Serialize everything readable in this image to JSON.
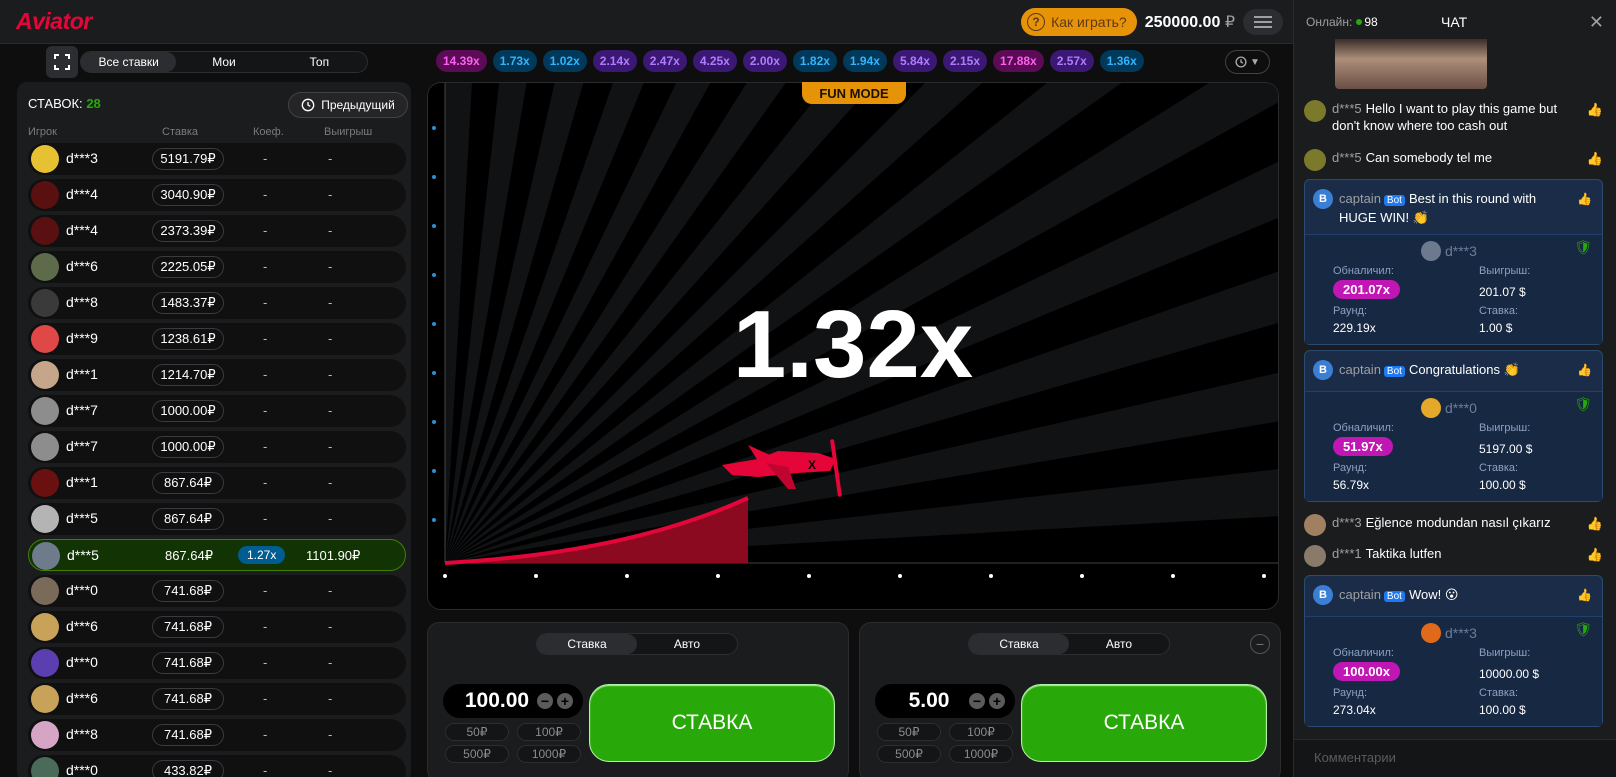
{
  "topbar": {
    "logo": "Aviator",
    "howto_label": "Как играть?",
    "balance_value": "250000.00",
    "balance_currency": "₽"
  },
  "left_tabs": [
    "Все ставки",
    "Мои",
    "Топ"
  ],
  "bets": {
    "label": "СТАВОК:",
    "count": "28",
    "prev_label": "Предыдущий",
    "columns": [
      "Игрок",
      "Ставка",
      "Коеф.",
      "Выигрыш"
    ],
    "rows": [
      {
        "name": "d***3",
        "bet": "5191.79₽",
        "coef": "-",
        "win": "-",
        "color": "#e6c233"
      },
      {
        "name": "d***4",
        "bet": "3040.90₽",
        "coef": "-",
        "win": "-",
        "color": "#5a1010"
      },
      {
        "name": "d***4",
        "bet": "2373.39₽",
        "coef": "-",
        "win": "-",
        "color": "#5a1010"
      },
      {
        "name": "d***6",
        "bet": "2225.05₽",
        "coef": "-",
        "win": "-",
        "color": "#5d6b4a"
      },
      {
        "name": "d***8",
        "bet": "1483.37₽",
        "coef": "-",
        "win": "-",
        "color": "#3a3a3a"
      },
      {
        "name": "d***9",
        "bet": "1238.61₽",
        "coef": "-",
        "win": "-",
        "color": "#e04848"
      },
      {
        "name": "d***1",
        "bet": "1214.70₽",
        "coef": "-",
        "win": "-",
        "color": "#c6a68b"
      },
      {
        "name": "d***7",
        "bet": "1000.00₽",
        "coef": "-",
        "win": "-",
        "color": "#8d8d8d"
      },
      {
        "name": "d***7",
        "bet": "1000.00₽",
        "coef": "-",
        "win": "-",
        "color": "#8d8d8d"
      },
      {
        "name": "d***1",
        "bet": "867.64₽",
        "coef": "-",
        "win": "-",
        "color": "#6b1010"
      },
      {
        "name": "d***5",
        "bet": "867.64₽",
        "coef": "-",
        "win": "-",
        "color": "#b4b4b4"
      },
      {
        "name": "d***5",
        "bet": "867.64₽",
        "coef": "1.27x",
        "win": "1101.90₽",
        "color": "#6e7b8b",
        "win_row": true
      },
      {
        "name": "d***0",
        "bet": "741.68₽",
        "coef": "-",
        "win": "-",
        "color": "#7a6a5a"
      },
      {
        "name": "d***6",
        "bet": "741.68₽",
        "coef": "-",
        "win": "-",
        "color": "#c9a25a"
      },
      {
        "name": "d***0",
        "bet": "741.68₽",
        "coef": "-",
        "win": "-",
        "color": "#5b3fb1"
      },
      {
        "name": "d***6",
        "bet": "741.68₽",
        "coef": "-",
        "win": "-",
        "color": "#c9a25a"
      },
      {
        "name": "d***8",
        "bet": "741.68₽",
        "coef": "-",
        "win": "-",
        "color": "#d6a4c4"
      },
      {
        "name": "d***0",
        "bet": "433.82₽",
        "coef": "-",
        "win": "-",
        "color": "#4a6a5a"
      }
    ]
  },
  "history": [
    {
      "v": "14.39x",
      "c": "#c017b4"
    },
    {
      "v": "1.73x",
      "c": "#34b4ff"
    },
    {
      "v": "1.02x",
      "c": "#34b4ff"
    },
    {
      "v": "2.14x",
      "c": "#913ef8"
    },
    {
      "v": "2.47x",
      "c": "#913ef8"
    },
    {
      "v": "4.25x",
      "c": "#913ef8"
    },
    {
      "v": "2.00x",
      "c": "#913ef8"
    },
    {
      "v": "1.82x",
      "c": "#34b4ff"
    },
    {
      "v": "1.94x",
      "c": "#34b4ff"
    },
    {
      "v": "5.84x",
      "c": "#913ef8"
    },
    {
      "v": "2.15x",
      "c": "#913ef8"
    },
    {
      "v": "17.88x",
      "c": "#c017b4"
    },
    {
      "v": "2.57x",
      "c": "#913ef8"
    },
    {
      "v": "1.36x",
      "c": "#34b4ff"
    }
  ],
  "game": {
    "fun_mode": "FUN MODE",
    "multiplier": "1.32x"
  },
  "bet_panels": [
    {
      "mode_tabs": [
        "Ставка",
        "Авто"
      ],
      "amount": "100.00",
      "quick": [
        "50₽",
        "100₽",
        "500₽",
        "1000₽"
      ],
      "button": "СТАВКА"
    },
    {
      "mode_tabs": [
        "Ставка",
        "Авто"
      ],
      "amount": "5.00",
      "quick": [
        "50₽",
        "100₽",
        "500₽",
        "1000₽"
      ],
      "button": "СТАВКА"
    }
  ],
  "chat": {
    "online_label": "Онлайн:",
    "online_count": "98",
    "title": "ЧАТ",
    "close": "✕",
    "messages": [
      {
        "name": "d***5",
        "text": "Hello I want to play this game but don't know where too cash out"
      },
      {
        "name": "d***5",
        "text": "Can somebody tel me"
      },
      {
        "name": "d***3",
        "text": "Eğlence modundan nasıl çıkarız"
      },
      {
        "name": "d***1",
        "text": "Taktika lutfen"
      }
    ],
    "bot_cards": [
      {
        "name": "captain",
        "bot": "Bot",
        "text": "Best in this round with HUGE WIN! 👏",
        "user": "d***3",
        "cashed_label": "Обналичил:",
        "cashed": "201.07x",
        "win_label": "Выигрыш:",
        "win": "201.07 $",
        "round_label": "Раунд:",
        "round": "229.19x",
        "stake_label": "Ставка:",
        "stake": "1.00 $"
      },
      {
        "name": "captain",
        "bot": "Bot",
        "text": "Congratulations 👏",
        "user": "d***0",
        "cashed_label": "Обналичил:",
        "cashed": "51.97x",
        "win_label": "Выигрыш:",
        "win": "5197.00 $",
        "round_label": "Раунд:",
        "round": "56.79x",
        "stake_label": "Ставка:",
        "stake": "100.00 $"
      },
      {
        "name": "captain",
        "bot": "Bot",
        "text": "Wow! 😮",
        "user": "d***3",
        "cashed_label": "Обналичил:",
        "cashed": "100.00x",
        "win_label": "Выигрыш:",
        "win": "10000.00 $",
        "round_label": "Раунд:",
        "round": "273.04x",
        "stake_label": "Ставка:",
        "stake": "100.00 $"
      }
    ],
    "input_placeholder": "Комментарии"
  }
}
